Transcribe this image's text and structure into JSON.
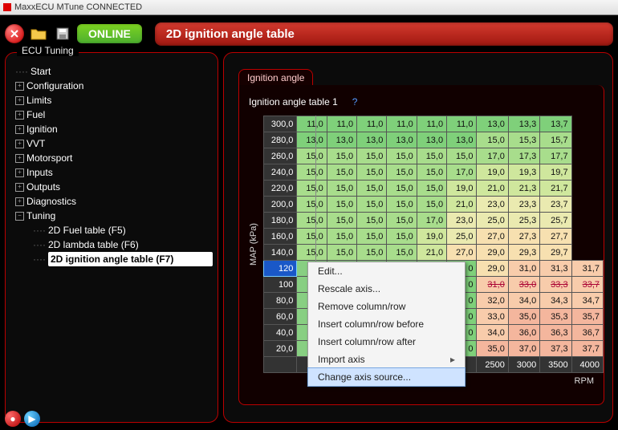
{
  "window": {
    "title": "MaxxECU MTune CONNECTED"
  },
  "toolbar": {
    "status": "ONLINE"
  },
  "header": {
    "title": "2D ignition angle table"
  },
  "side_tab": "ECU Tuning",
  "tree": {
    "items": [
      {
        "label": "Start",
        "exp": false,
        "children": []
      },
      {
        "label": "Configuration",
        "exp": true,
        "children": []
      },
      {
        "label": "Limits",
        "exp": true,
        "children": []
      },
      {
        "label": "Fuel",
        "exp": true,
        "children": []
      },
      {
        "label": "Ignition",
        "exp": true,
        "children": []
      },
      {
        "label": "VVT",
        "exp": true,
        "children": []
      },
      {
        "label": "Motorsport",
        "exp": true,
        "children": []
      },
      {
        "label": "Inputs",
        "exp": true,
        "children": []
      },
      {
        "label": "Outputs",
        "exp": true,
        "children": []
      },
      {
        "label": "Diagnostics",
        "exp": true,
        "children": []
      },
      {
        "label": "Tuning",
        "exp": false,
        "children": [
          {
            "label": "2D Fuel table (F5)",
            "sel": false
          },
          {
            "label": "2D lambda table (F6)",
            "sel": false
          },
          {
            "label": "2D ignition angle table (F7)",
            "sel": true
          }
        ]
      }
    ]
  },
  "content": {
    "tab": "Ignition angle",
    "subtitle": "Ignition angle table 1",
    "xlabel": "RPM",
    "ylabel": "MAP (kPa)"
  },
  "table": {
    "row_headers": [
      "300,0",
      "280,0",
      "260,0",
      "240,0",
      "220,0",
      "200,0",
      "180,0",
      "160,0",
      "140,0",
      "120",
      "100",
      "80,0",
      "60,0",
      "40,0",
      "20,0"
    ],
    "col_headers_visible": [
      "2500",
      "3000",
      "3500",
      "4000"
    ],
    "selected_row_header_index": 9,
    "cells": [
      [
        "11,0",
        "11,0",
        "11,0",
        "11,0",
        "11,0",
        "11,0",
        "13,0",
        "13,3",
        "13,7"
      ],
      [
        "13,0",
        "13,0",
        "13,0",
        "13,0",
        "13,0",
        "13,0",
        "15,0",
        "15,3",
        "15,7"
      ],
      [
        "15,0",
        "15,0",
        "15,0",
        "15,0",
        "15,0",
        "15,0",
        "17,0",
        "17,3",
        "17,7"
      ],
      [
        "15,0",
        "15,0",
        "15,0",
        "15,0",
        "15,0",
        "17,0",
        "19,0",
        "19,3",
        "19,7"
      ],
      [
        "15,0",
        "15,0",
        "15,0",
        "15,0",
        "15,0",
        "19,0",
        "21,0",
        "21,3",
        "21,7"
      ],
      [
        "15,0",
        "15,0",
        "15,0",
        "15,0",
        "15,0",
        "21,0",
        "23,0",
        "23,3",
        "23,7"
      ],
      [
        "15,0",
        "15,0",
        "15,0",
        "15,0",
        "17,0",
        "23,0",
        "25,0",
        "25,3",
        "25,7"
      ],
      [
        "15,0",
        "15,0",
        "15,0",
        "15,0",
        "19,0",
        "25,0",
        "27,0",
        "27,3",
        "27,7"
      ],
      [
        "15,0",
        "15,0",
        "15,0",
        "15,0",
        "21,0",
        "27,0",
        "29,0",
        "29,3",
        "29,7"
      ],
      [
        "",
        "",
        "",
        "",
        "",
        "0",
        "29,0",
        "31,0",
        "31,3",
        "31,7"
      ],
      [
        "",
        "",
        "",
        "",
        "",
        "0",
        "31,0",
        "33,0",
        "33,3",
        "33,7"
      ],
      [
        "",
        "",
        "",
        "",
        "",
        "0",
        "32,0",
        "34,0",
        "34,3",
        "34,7"
      ],
      [
        "",
        "",
        "",
        "",
        "",
        "0",
        "33,0",
        "35,0",
        "35,3",
        "35,7"
      ],
      [
        "",
        "",
        "",
        "",
        "",
        "0",
        "34,0",
        "36,0",
        "36,3",
        "36,7"
      ],
      [
        "",
        "",
        "",
        "",
        "",
        "0",
        "35,0",
        "37,0",
        "37,3",
        "37,7"
      ]
    ]
  },
  "context_menu": {
    "items": [
      {
        "label": "Edit...",
        "arrow": false,
        "sel": false
      },
      {
        "label": "Rescale axis...",
        "arrow": false,
        "sel": false
      },
      {
        "label": "Remove column/row",
        "arrow": false,
        "sel": false
      },
      {
        "label": "Insert column/row before",
        "arrow": false,
        "sel": false
      },
      {
        "label": "Insert column/row after",
        "arrow": false,
        "sel": false
      },
      {
        "label": "Import axis",
        "arrow": true,
        "sel": false
      },
      {
        "label": "Change axis source...",
        "arrow": false,
        "sel": true
      }
    ]
  }
}
